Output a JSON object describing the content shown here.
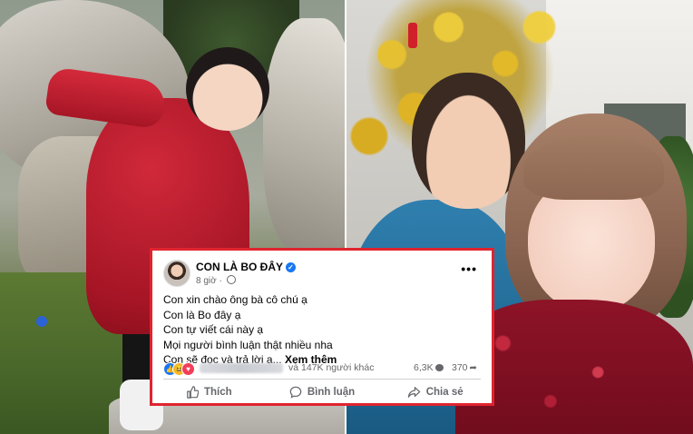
{
  "post": {
    "page_name": "CON LÀ BO ĐÂY",
    "time": "8 giờ",
    "lines": [
      "Con xin chào ông bà cô chú ạ",
      "Con là Bo đây ạ",
      "Con tự viết cái này ạ",
      "Mọi người bình luận thật nhiều nha",
      "Con sẽ đọc và trả lời ạ..."
    ],
    "see_more": "Xem thêm",
    "reactions_others": "và 147K người khác",
    "comments": "6,3K",
    "shares": "370",
    "actions": {
      "like": "Thích",
      "comment": "Bình luận",
      "share": "Chia sẻ"
    }
  },
  "colors": {
    "card_border": "#e0242f",
    "facebook_blue": "#1877f2",
    "muted_text": "#65676b"
  },
  "icons": [
    "verified-badge-icon",
    "globe-icon",
    "more-options-icon",
    "like-reaction-icon",
    "haha-reaction-icon",
    "love-reaction-icon",
    "comment-icon",
    "share-icon",
    "thumbs-up-icon"
  ]
}
